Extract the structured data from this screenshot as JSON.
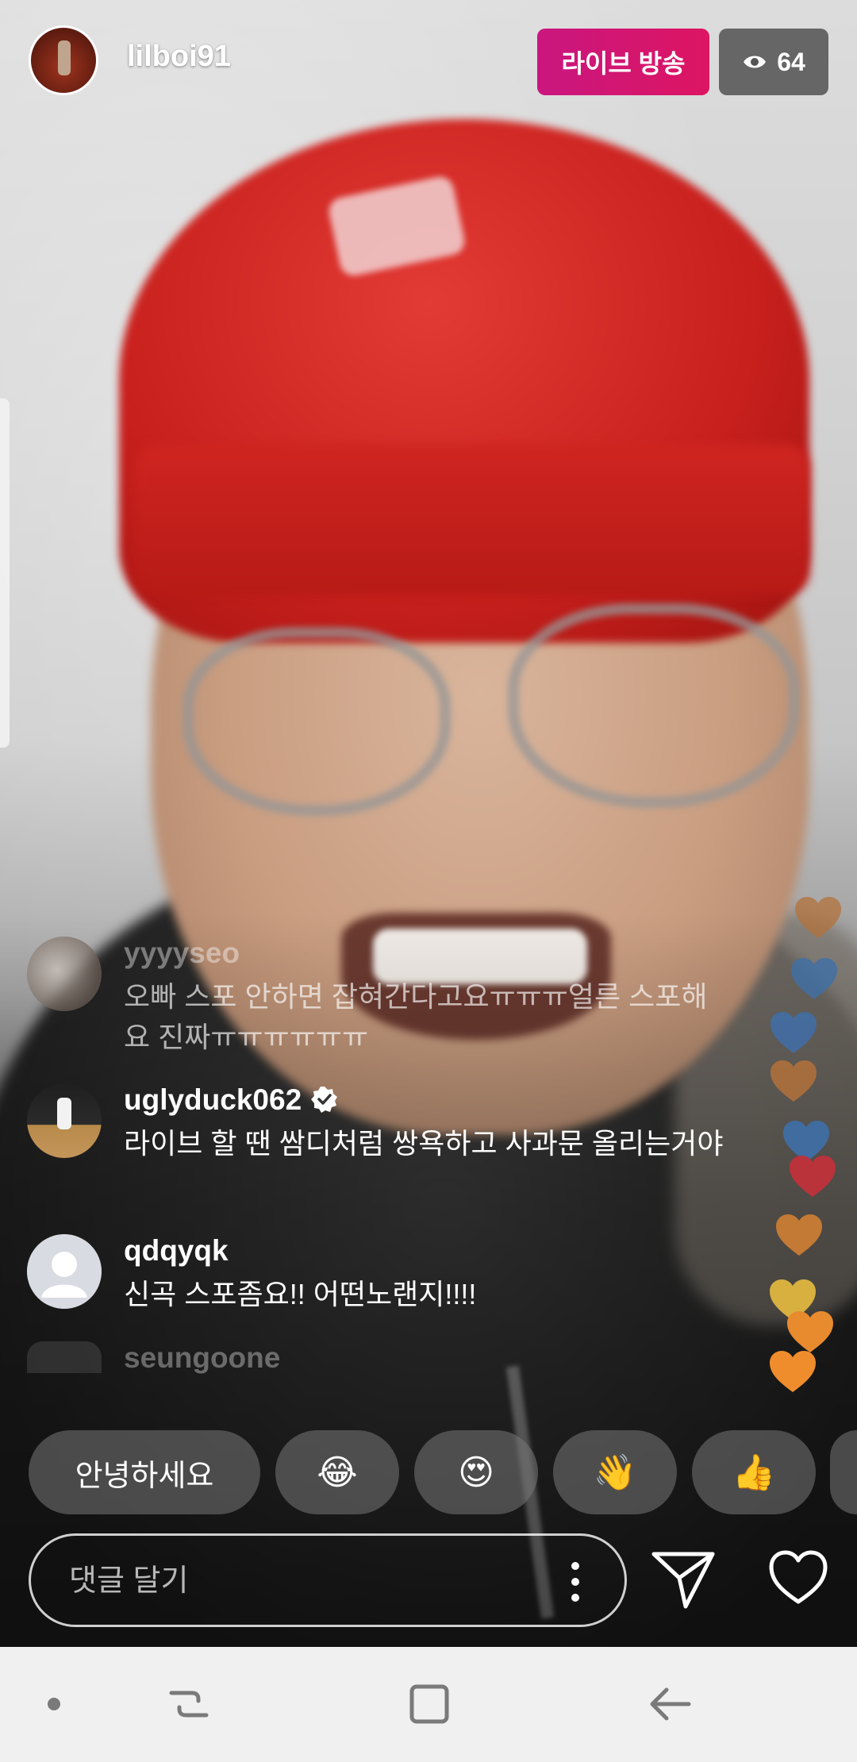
{
  "header": {
    "username": "lilboi91",
    "live_label": "라이브 방송",
    "viewer_count": "64"
  },
  "comments": [
    {
      "user": "yyyyseo",
      "text": "오빠 스포 안하면 잡혀간다고요ㅠㅠㅠ얼른 스포해요 진짜ㅠㅠㅠㅠㅠㅠ"
    },
    {
      "user": "uglyduck062",
      "verified": true,
      "text": "라이브 할 땐 쌈디처럼 쌍욕하고 사과문 올리는거야"
    },
    {
      "user": "qdqyqk",
      "text": "신곡 스포좀요!! 어떤노랜지!!!!"
    },
    {
      "user": "seungoone",
      "text": ""
    }
  ],
  "quick_replies": [
    {
      "label": "안녕하세요"
    },
    {
      "label": "😂"
    },
    {
      "label": "😍"
    },
    {
      "label": "👋"
    },
    {
      "label": "👍"
    }
  ],
  "input": {
    "placeholder": "댓글 달기"
  },
  "colors": {
    "live_gradient_start": "#c9167f",
    "live_gradient_end": "#dd1562",
    "heart_orange": "#e88a2e",
    "heart_blue": "#3f6fa8",
    "heart_red": "#c0303a",
    "heart_yellow": "#d8b040",
    "heart_brown": "#b3713b"
  }
}
